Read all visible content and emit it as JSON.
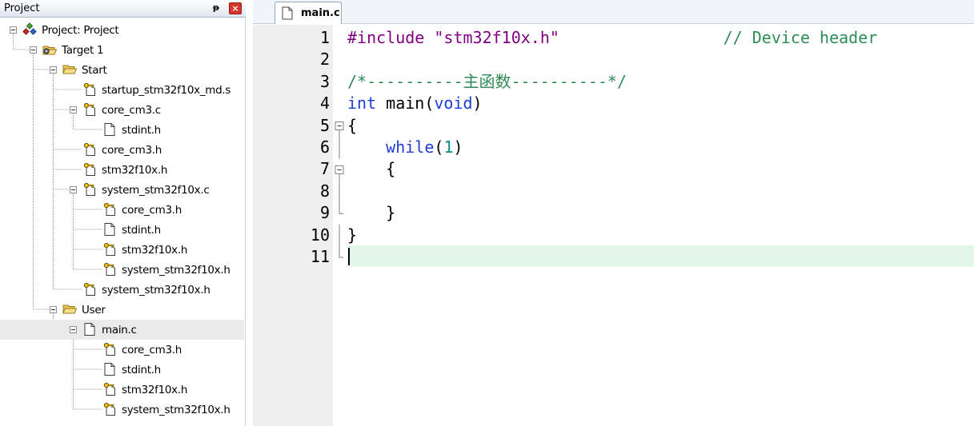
{
  "panel": {
    "title": "Project",
    "pin_glyph": "ᵽ",
    "close_glyph": "×"
  },
  "tree": [
    {
      "label": "Project: Project",
      "icon": "project-icon",
      "level": 0,
      "expander": true
    },
    {
      "label": "Target 1",
      "icon": "target-icon",
      "level": 1,
      "expander": true
    },
    {
      "label": "Start",
      "icon": "folder-open-icon",
      "level": 2,
      "expander": true
    },
    {
      "label": "startup_stm32f10x_md.s",
      "icon": "key-file-icon",
      "level": 3,
      "expander": false
    },
    {
      "label": "core_cm3.c",
      "icon": "key-file-icon",
      "level": 3,
      "expander": true
    },
    {
      "label": "stdint.h",
      "icon": "file-icon",
      "level": 4,
      "expander": false
    },
    {
      "label": "core_cm3.h",
      "icon": "key-file-icon",
      "level": 3,
      "expander": false
    },
    {
      "label": "stm32f10x.h",
      "icon": "key-file-icon",
      "level": 3,
      "expander": false
    },
    {
      "label": "system_stm32f10x.c",
      "icon": "key-file-icon",
      "level": 3,
      "expander": true
    },
    {
      "label": "core_cm3.h",
      "icon": "key-file-icon",
      "level": 4,
      "expander": false
    },
    {
      "label": "stdint.h",
      "icon": "file-icon",
      "level": 4,
      "expander": false
    },
    {
      "label": "stm32f10x.h",
      "icon": "key-file-icon",
      "level": 4,
      "expander": false
    },
    {
      "label": "system_stm32f10x.h",
      "icon": "key-file-icon",
      "level": 4,
      "expander": false
    },
    {
      "label": "system_stm32f10x.h",
      "icon": "key-file-icon",
      "level": 3,
      "expander": false
    },
    {
      "label": "User",
      "icon": "folder-open-icon",
      "level": 2,
      "expander": true
    },
    {
      "label": "main.c",
      "icon": "file-icon",
      "level": 3,
      "expander": true,
      "selected": true
    },
    {
      "label": "core_cm3.h",
      "icon": "key-file-icon",
      "level": 4,
      "expander": false
    },
    {
      "label": "stdint.h",
      "icon": "file-icon",
      "level": 4,
      "expander": false
    },
    {
      "label": "stm32f10x.h",
      "icon": "key-file-icon",
      "level": 4,
      "expander": false
    },
    {
      "label": "system_stm32f10x.h",
      "icon": "key-file-icon",
      "level": 4,
      "expander": false
    }
  ],
  "editor": {
    "tab_label": "main.c",
    "lines": [
      {
        "no": "1",
        "tokens": [
          {
            "t": "#include ",
            "c": "pp"
          },
          {
            "t": "\"stm32f10x.h\"",
            "c": "str"
          },
          {
            "t": "                 ",
            "c": "plain"
          },
          {
            "t": "// Device header",
            "c": "cmt"
          }
        ]
      },
      {
        "no": "2",
        "tokens": []
      },
      {
        "no": "3",
        "tokens": [
          {
            "t": "/*----------主函数----------*/",
            "c": "cmt"
          }
        ]
      },
      {
        "no": "4",
        "tokens": [
          {
            "t": "int",
            "c": "kw"
          },
          {
            "t": " main(",
            "c": "plain"
          },
          {
            "t": "void",
            "c": "kw"
          },
          {
            "t": ")",
            "c": "plain"
          }
        ]
      },
      {
        "no": "5",
        "tokens": [
          {
            "t": "{",
            "c": "plain"
          }
        ],
        "fold": "box"
      },
      {
        "no": "6",
        "tokens": [
          {
            "t": "    ",
            "c": "plain"
          },
          {
            "t": "while",
            "c": "kw"
          },
          {
            "t": "(",
            "c": "plain"
          },
          {
            "t": "1",
            "c": "num"
          },
          {
            "t": ")",
            "c": "plain"
          }
        ],
        "fold": "line"
      },
      {
        "no": "7",
        "tokens": [
          {
            "t": "    {",
            "c": "plain"
          }
        ],
        "fold": "box"
      },
      {
        "no": "8",
        "tokens": [],
        "fold": "line"
      },
      {
        "no": "9",
        "tokens": [
          {
            "t": "    }",
            "c": "plain"
          }
        ],
        "fold": "end"
      },
      {
        "no": "10",
        "tokens": [
          {
            "t": "}",
            "c": "plain"
          }
        ],
        "fold": "line"
      },
      {
        "no": "11",
        "tokens": [],
        "fold": "end",
        "current": true
      }
    ]
  },
  "colors": {
    "keyword": "#1f3ed6",
    "preprocessor": "#800080",
    "comment": "#2e8b57",
    "number": "#0b8a8a",
    "current_line": "#e3f6e8",
    "gutter": "#efefef"
  }
}
